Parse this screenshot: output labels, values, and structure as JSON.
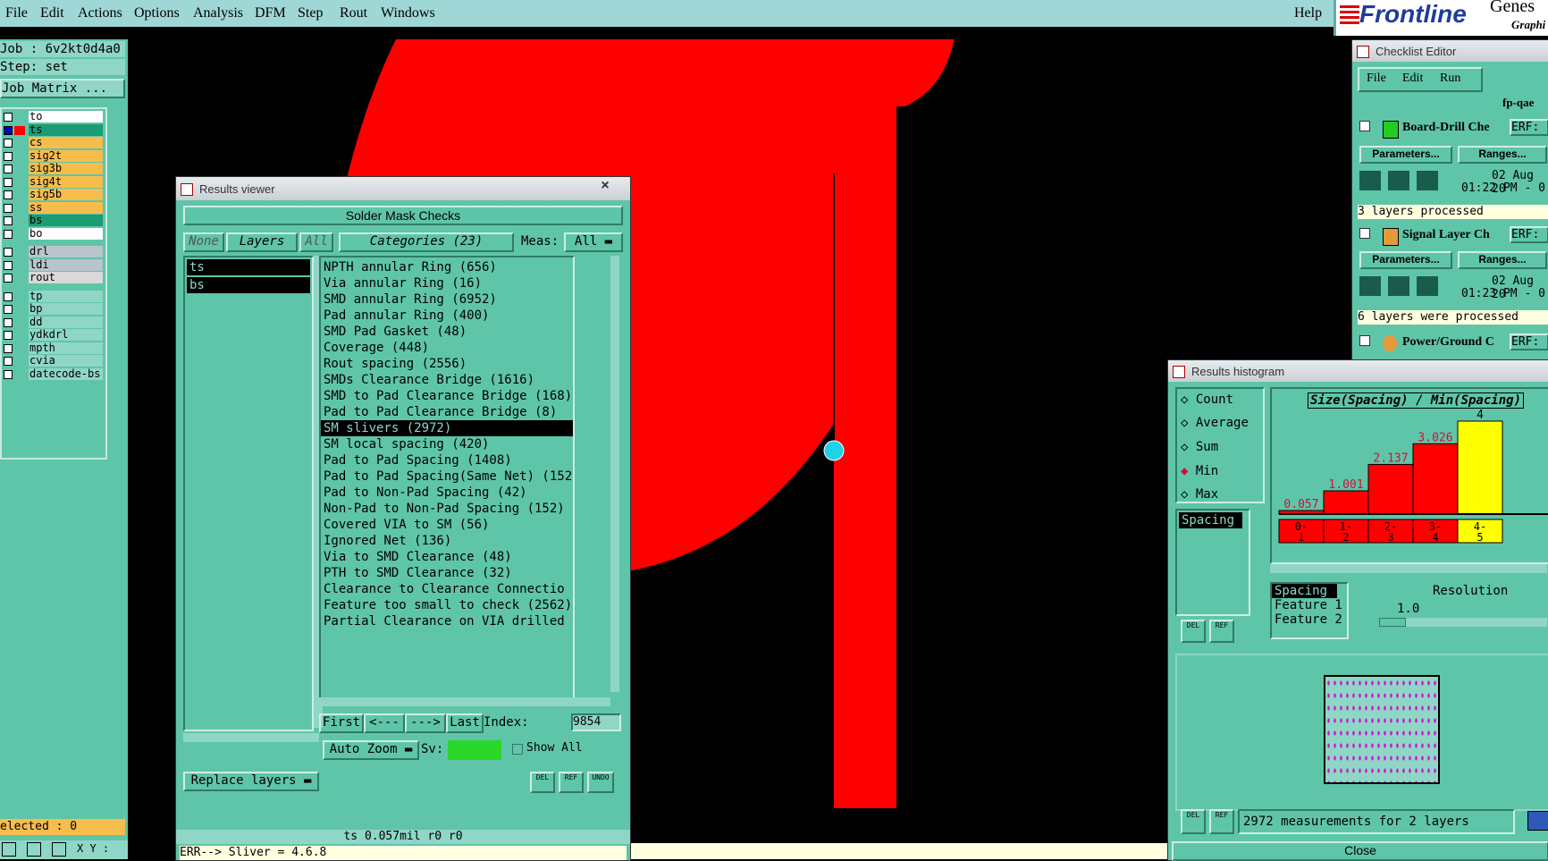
{
  "menubar": {
    "items": [
      "File",
      "Edit",
      "Actions",
      "Options",
      "Analysis",
      "DFM",
      "Step",
      "Rout",
      "Windows"
    ],
    "help": "Help",
    "brand": "Frontline",
    "brand_suffix": "Genes",
    "brand_sub": "Graphi"
  },
  "job": {
    "job_label": "Job : 6v2kt0d4a0",
    "step_label": "Step: set",
    "matrix_button": "Job Matrix ..."
  },
  "layers": [
    {
      "name": "to",
      "color": "#ffffff"
    },
    {
      "name": "ts",
      "color": "#1a9c74"
    },
    {
      "name": "cs",
      "color": "#f6bd4d"
    },
    {
      "name": "sig2t",
      "color": "#f6bd4d"
    },
    {
      "name": "sig3b",
      "color": "#f6bd4d"
    },
    {
      "name": "sig4t",
      "color": "#f6bd4d"
    },
    {
      "name": "sig5b",
      "color": "#f6bd4d"
    },
    {
      "name": "ss",
      "color": "#f6bd4d"
    },
    {
      "name": "bs",
      "color": "#1a9c74"
    },
    {
      "name": "bo",
      "color": "#ffffff"
    },
    {
      "name": "drl",
      "color": "#b9c4cc"
    },
    {
      "name": "ldi",
      "color": "#b9c4cc"
    },
    {
      "name": "rout",
      "color": "#d9d9d9"
    },
    {
      "name": "tp",
      "color": "#8fd6c6"
    },
    {
      "name": "bp",
      "color": "#8fd6c6"
    },
    {
      "name": "dd",
      "color": "#8fd6c6"
    },
    {
      "name": "ydkdrl",
      "color": "#8fd6c6"
    },
    {
      "name": "mpth",
      "color": "#8fd6c6"
    },
    {
      "name": "cvia",
      "color": "#8fd6c6"
    },
    {
      "name": "datecode-bs",
      "color": "#8fd6c6"
    }
  ],
  "selected_label": "elected : 0",
  "coords_label": "X Y :",
  "results_viewer": {
    "title": "Results viewer",
    "close": "×",
    "header": "Solder Mask Checks",
    "none": "None",
    "layers_btn": "Layers",
    "all": "All",
    "categories_btn": "Categories (23)",
    "meas_label": "Meas:",
    "meas_value": "All",
    "layer_list": [
      "ts",
      "bs"
    ],
    "categories": [
      "NPTH annular Ring (656)",
      "Via annular Ring (16)",
      "SMD annular Ring (6952)",
      "Pad annular Ring (400)",
      "SMD Pad Gasket (48)",
      "Coverage (448)",
      "Rout spacing (2556)",
      "SMDs Clearance Bridge (1616)",
      "SMD to Pad Clearance Bridge (168)",
      "Pad to Pad Clearance Bridge (8)",
      "SM slivers (2972)",
      "SM local spacing (420)",
      "Pad to Pad Spacing (1408)",
      "Pad to Pad Spacing(Same Net) (152",
      "Pad to Non-Pad Spacing (42)",
      "Non-Pad to Non-Pad Spacing (152)",
      "Covered VIA to SM (56)",
      "Ignored Net (136)",
      "Via to SMD Clearance (48)",
      "PTH to SMD Clearance (32)",
      "Clearance to Clearance Connectio",
      "Feature too small to check (2562)",
      "Partial Clearance on VIA drilled"
    ],
    "selected_index": 10,
    "first": "First",
    "prev": "<---",
    "next": "--->",
    "last": "Last",
    "index_label": "Index:",
    "index_value": "9854",
    "auto_zoom": "Auto Zoom",
    "sv": "Sv:",
    "show_all": "Show All",
    "replace_layers": "Replace layers",
    "del": "DEL",
    "ref": "REF",
    "undo": "UNDO",
    "status": "ts 0.057mil  r0  r0",
    "err": "ERR--> Sliver = 4.6.8"
  },
  "checklist": {
    "title": "Checklist Editor",
    "menu": [
      "File",
      "Edit",
      "Run"
    ],
    "job": "fp-qae",
    "items": [
      {
        "name": "Board-Drill Che",
        "erf": "ERF:",
        "date": "02 Aug 20",
        "time": "01:22 PM - 0",
        "status": "3 layers processed"
      },
      {
        "name": "Signal Layer Ch",
        "erf": "ERF:",
        "date": "02 Aug 20",
        "time": "01:23 PM - 0",
        "status": "6 layers were processed"
      },
      {
        "name": "Power/Ground C",
        "erf": "ERF:"
      }
    ],
    "params": "Parameters...",
    "ranges": "Ranges..."
  },
  "histogram": {
    "title": "Results histogram",
    "measures": [
      "Count",
      "Average",
      "Sum",
      "Min",
      "Max"
    ],
    "selected_measure": "Min",
    "left_list": [
      "Spacing"
    ],
    "chart_title": "Size(Spacing) / Min(Spacing)",
    "bottom_list": [
      "Spacing",
      "Feature 1",
      "Feature 2"
    ],
    "resolution_label": "Resolution",
    "resolution_value": "1.0",
    "summary": "2972 measurements for 2 layers",
    "close": "Close",
    "del": "DEL",
    "ref": "REF"
  },
  "chart_data": {
    "type": "bar",
    "categories": [
      "0-1",
      "1-2",
      "2-3",
      "3-4",
      "4-5"
    ],
    "values": [
      0.057,
      1.001,
      2.137,
      3.026,
      4
    ],
    "labels": [
      "0.057",
      "1.001",
      "2.137",
      "3.026",
      "4"
    ],
    "colors": [
      "#ff0000",
      "#ff0000",
      "#ff0000",
      "#ff0000",
      "#ffff00"
    ],
    "title": "Size(Spacing) / Min(Spacing)",
    "ylim": [
      0,
      4
    ]
  }
}
